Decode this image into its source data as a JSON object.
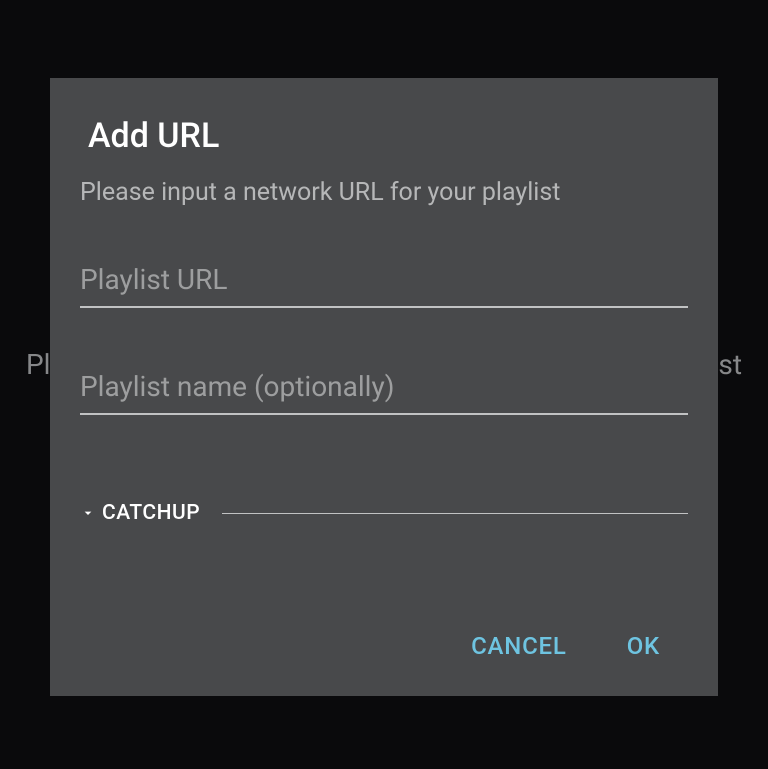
{
  "background": {
    "leftText": "Pl",
    "rightText": "ist"
  },
  "dialog": {
    "title": "Add URL",
    "subtitle": "Please input a network URL for your playlist",
    "urlField": {
      "placeholder": "Playlist URL",
      "value": ""
    },
    "nameField": {
      "placeholder": "Playlist name (optionally)",
      "value": ""
    },
    "catchup": {
      "label": "CATCHUP"
    },
    "buttons": {
      "cancel": "CANCEL",
      "ok": "OK"
    }
  }
}
